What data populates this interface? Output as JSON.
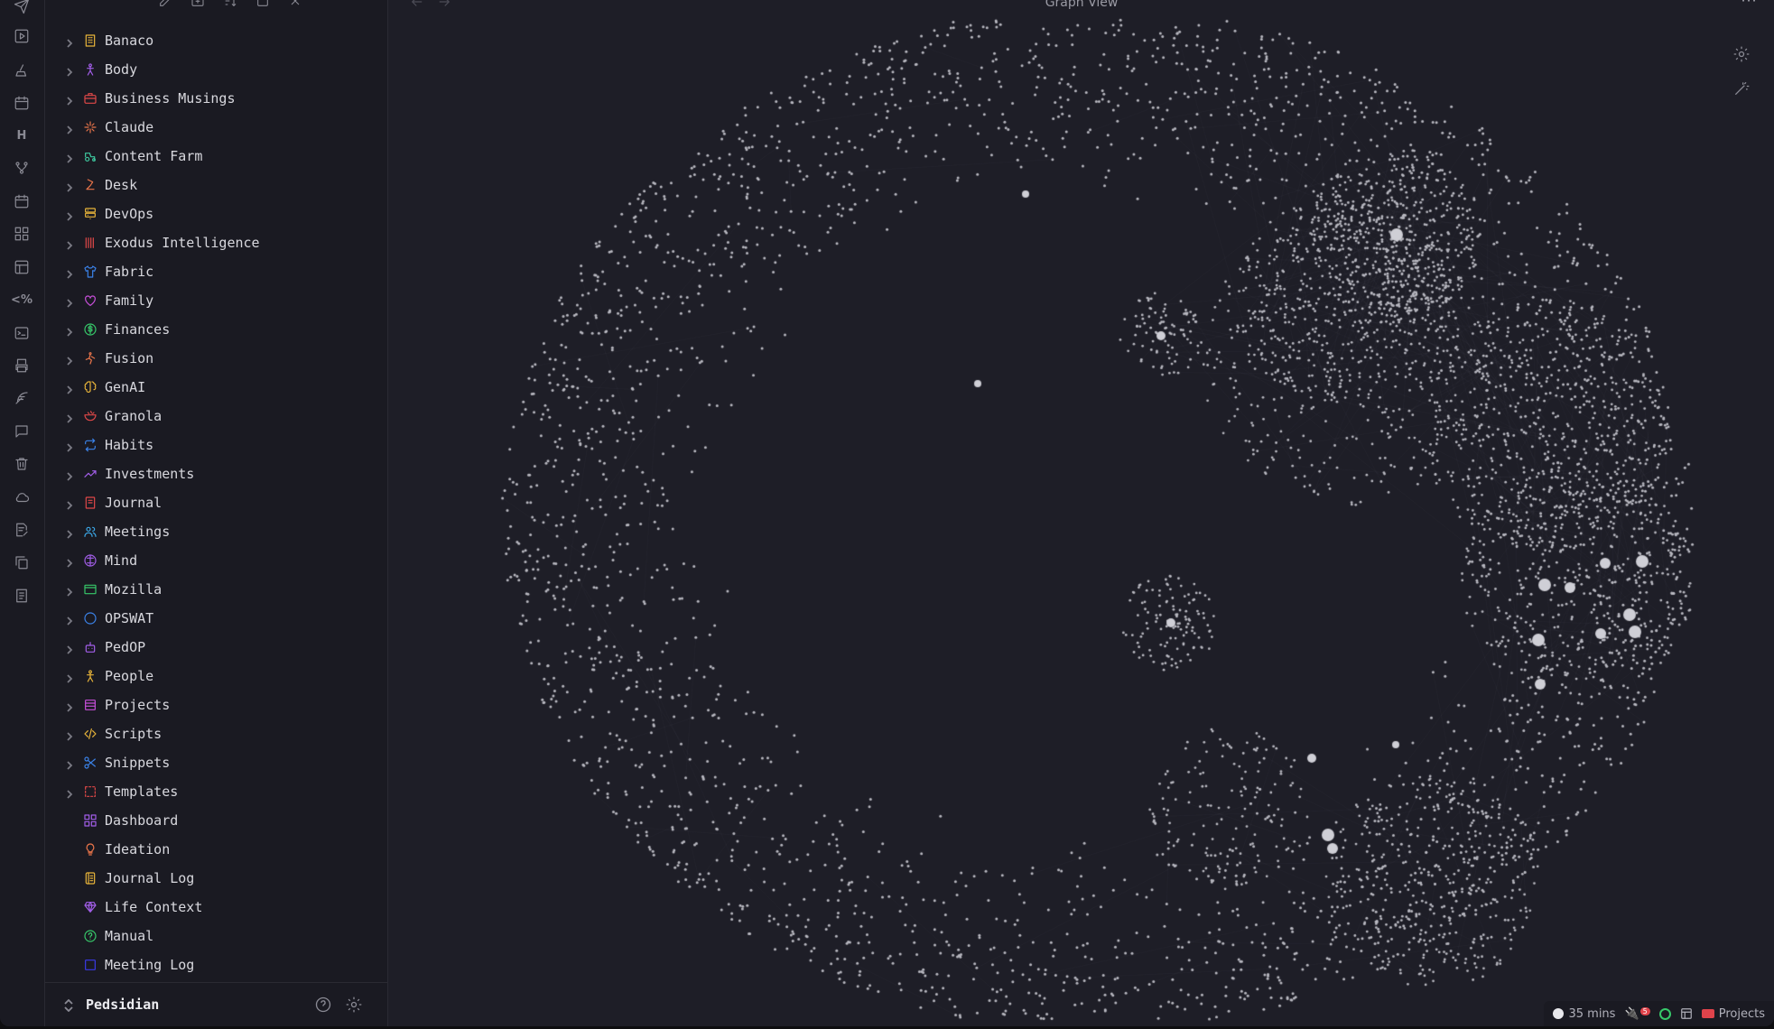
{
  "main": {
    "view_title": "Graph View",
    "more_icon": "⋯"
  },
  "sidebar": {
    "vault_name": "Pedsidian",
    "tree": [
      {
        "label": "Banaco",
        "icon": "building-icon",
        "color": "#e8b43a",
        "folder": true
      },
      {
        "label": "Body",
        "icon": "person-icon",
        "color": "#a25ee8",
        "folder": true
      },
      {
        "label": "Business Musings",
        "icon": "briefcase-icon",
        "color": "#e04848",
        "folder": true
      },
      {
        "label": "Claude",
        "icon": "sparkle-icon",
        "color": "#e8744a",
        "folder": true
      },
      {
        "label": "Content Farm",
        "icon": "tractor-icon",
        "color": "#3ec9a0",
        "folder": true
      },
      {
        "label": "Desk",
        "icon": "lamp-icon",
        "color": "#e8744a",
        "folder": true
      },
      {
        "label": "DevOps",
        "icon": "server-icon",
        "color": "#e8b43a",
        "folder": true
      },
      {
        "label": "Exodus Intelligence",
        "icon": "bars-icon",
        "color": "#e04848",
        "folder": true
      },
      {
        "label": "Fabric",
        "icon": "shirt-icon",
        "color": "#3b82e8",
        "folder": true
      },
      {
        "label": "Family",
        "icon": "heart-icon",
        "color": "#c64fd8",
        "folder": true
      },
      {
        "label": "Finances",
        "icon": "dollar-icon",
        "color": "#37c86a",
        "folder": true
      },
      {
        "label": "Fusion",
        "icon": "figure-icon",
        "color": "#e8744a",
        "folder": true
      },
      {
        "label": "GenAI",
        "icon": "brain-icon",
        "color": "#e8b43a",
        "folder": true
      },
      {
        "label": "Granola",
        "icon": "bowl-icon",
        "color": "#e04848",
        "folder": true
      },
      {
        "label": "Habits",
        "icon": "repeat-icon",
        "color": "#3b82e8",
        "folder": true
      },
      {
        "label": "Investments",
        "icon": "trend-icon",
        "color": "#a25ee8",
        "folder": true
      },
      {
        "label": "Journal",
        "icon": "book-icon",
        "color": "#e04848",
        "folder": true
      },
      {
        "label": "Meetings",
        "icon": "users-icon",
        "color": "#3ba8e8",
        "folder": true
      },
      {
        "label": "Mind",
        "icon": "mind-icon",
        "color": "#a25ee8",
        "folder": true
      },
      {
        "label": "Mozilla",
        "icon": "window-icon",
        "color": "#37c86a",
        "folder": true
      },
      {
        "label": "OPSWAT",
        "icon": "circle-icon",
        "color": "#3b82e8",
        "folder": true
      },
      {
        "label": "PedOP",
        "icon": "bot-icon",
        "color": "#a25ee8",
        "folder": true
      },
      {
        "label": "People",
        "icon": "person-icon",
        "color": "#e8b43a",
        "folder": true
      },
      {
        "label": "Projects",
        "icon": "stack-icon",
        "color": "#c64fd8",
        "folder": true
      },
      {
        "label": "Scripts",
        "icon": "code-icon",
        "color": "#e8b43a",
        "folder": true
      },
      {
        "label": "Snippets",
        "icon": "scissors-icon",
        "color": "#3b82e8",
        "folder": true
      },
      {
        "label": "Templates",
        "icon": "dashed-square-icon",
        "color": "#e04848",
        "folder": true
      },
      {
        "label": "Dashboard",
        "icon": "grid-icon",
        "color": "#a25ee8",
        "folder": false
      },
      {
        "label": "Ideation",
        "icon": "bulb-icon",
        "color": "#e8744a",
        "folder": false
      },
      {
        "label": "Journal Log",
        "icon": "log-icon",
        "color": "#e8b43a",
        "folder": false
      },
      {
        "label": "Life Context",
        "icon": "gem-icon",
        "color": "#a25ee8",
        "folder": false
      },
      {
        "label": "Manual",
        "icon": "help-icon",
        "color": "#37c86a",
        "folder": false
      },
      {
        "label": "Meeting Log",
        "icon": "square-icon",
        "color": "#3b3be8",
        "folder": false
      }
    ]
  },
  "status_bar": {
    "timer": "35 mins",
    "plugin_badge": "5",
    "folder_label": "Projects"
  }
}
